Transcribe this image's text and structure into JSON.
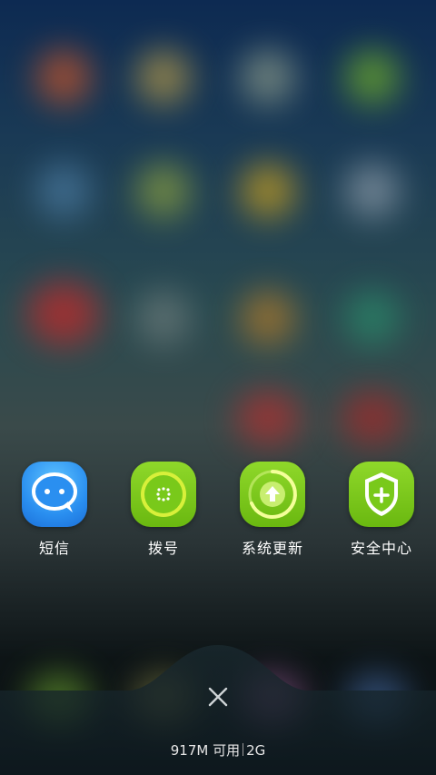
{
  "recent_apps": [
    {
      "label": "短信",
      "icon": "message-bubble-icon",
      "color": "#2a9af2"
    },
    {
      "label": "拨号",
      "icon": "dialpad-icon",
      "color": "#79c91a"
    },
    {
      "label": "系统更新",
      "icon": "system-update-icon",
      "color": "#79c91a"
    },
    {
      "label": "安全中心",
      "icon": "shield-plus-icon",
      "color": "#79c91a"
    }
  ],
  "close_icon": "close-icon",
  "memory": {
    "available": "917M 可用",
    "total": "2G"
  }
}
